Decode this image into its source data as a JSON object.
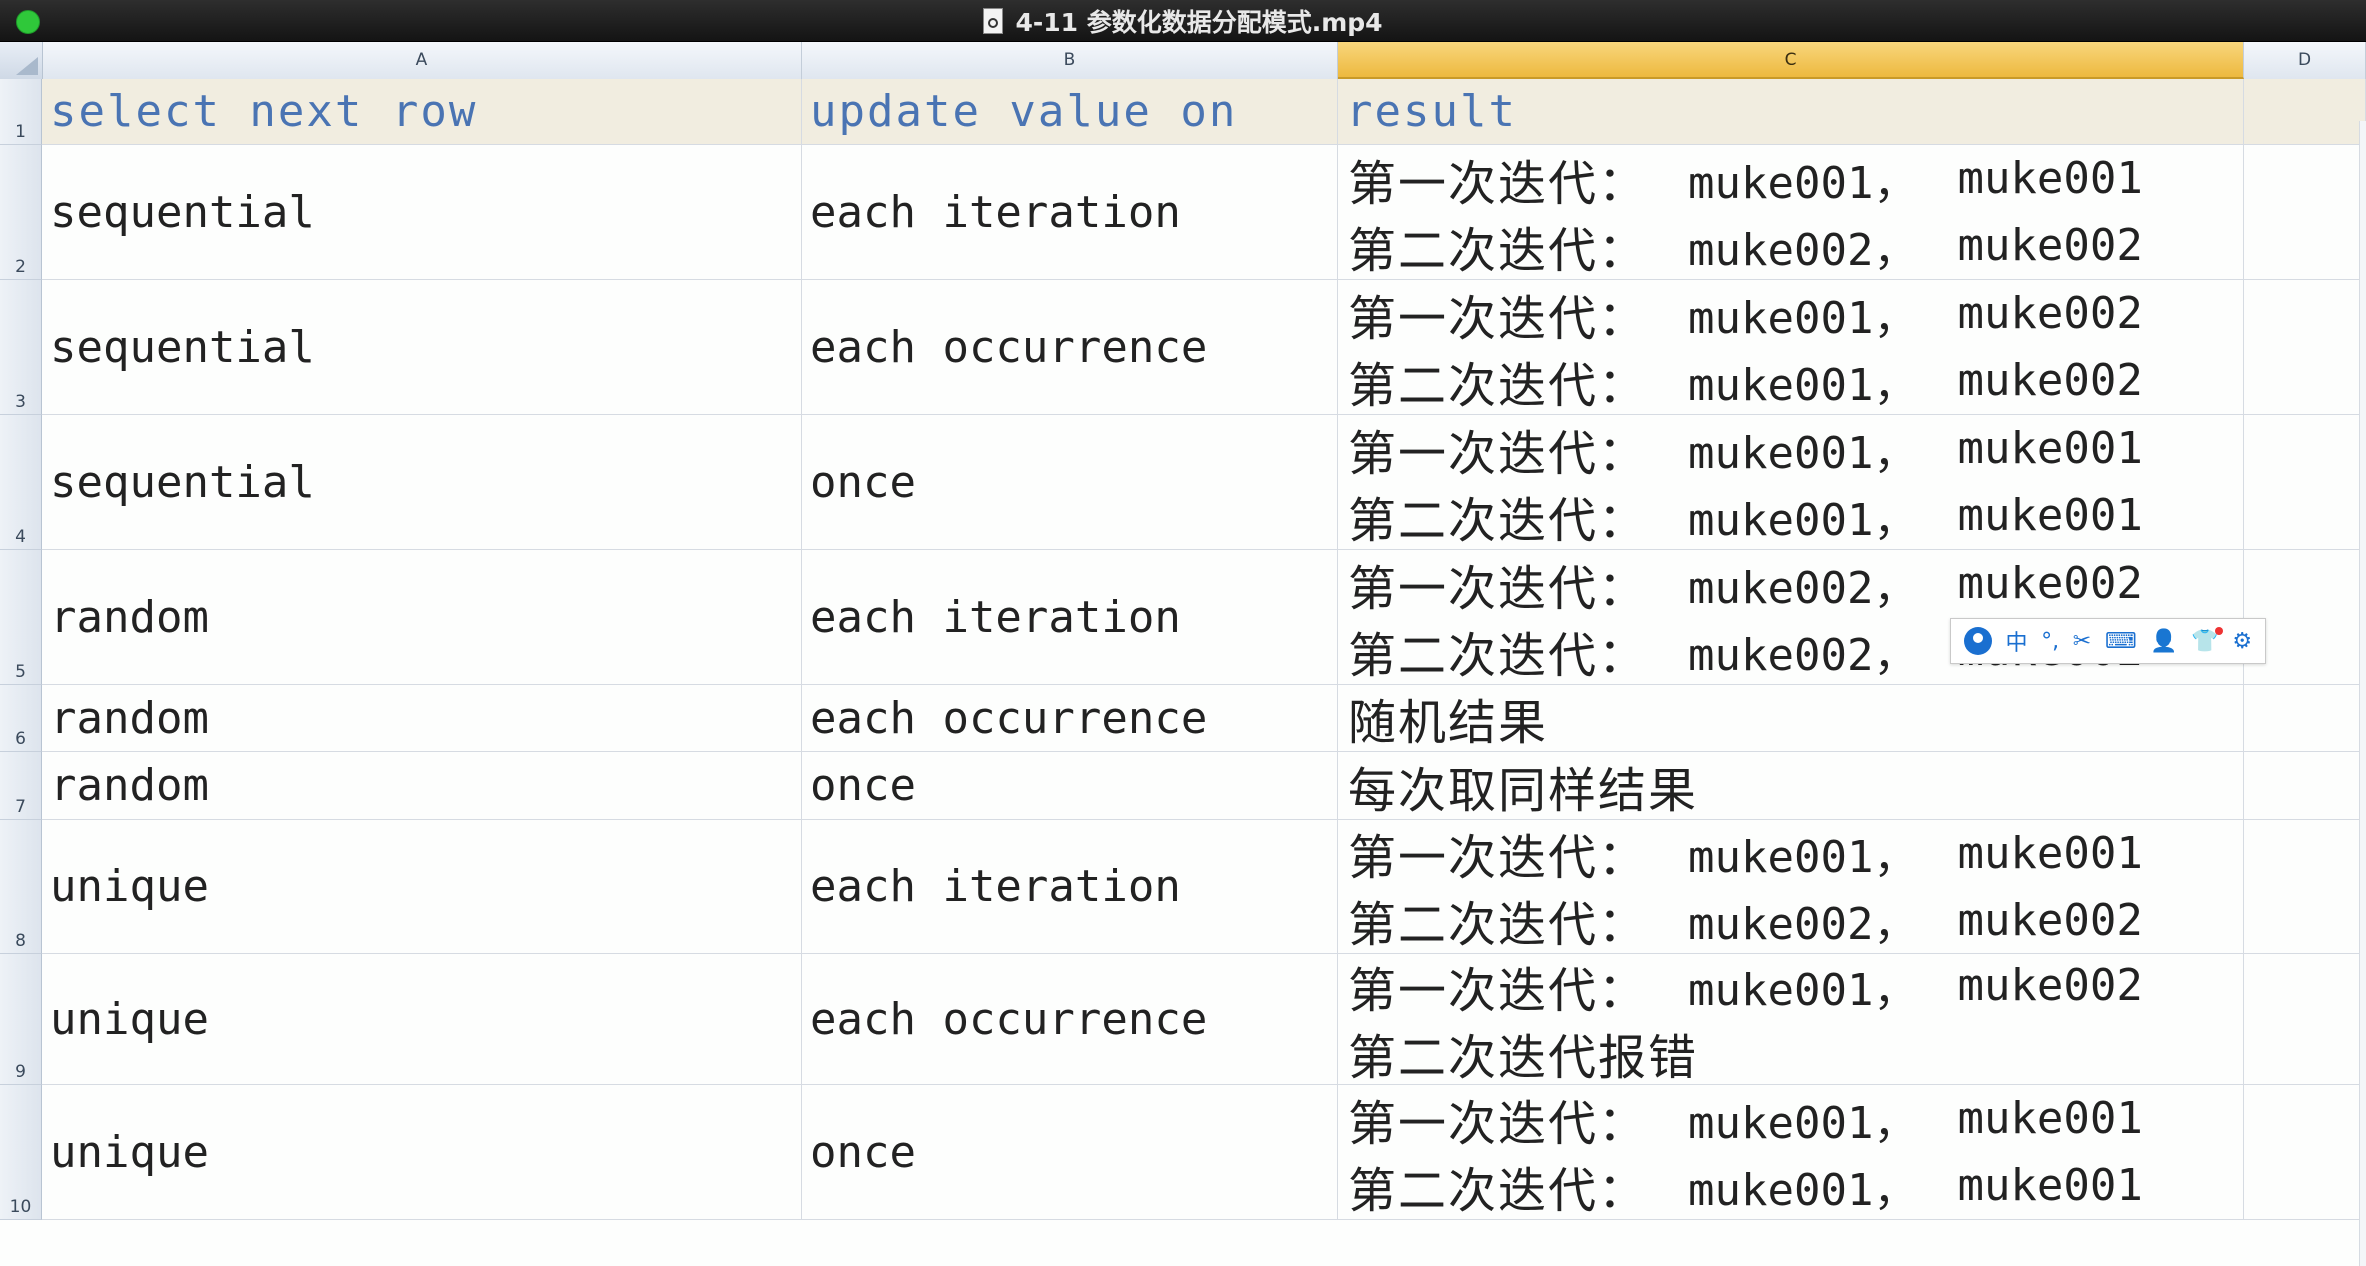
{
  "window": {
    "title": "4-11 参数化数据分配模式.mp4"
  },
  "columns": [
    "A",
    "B",
    "C",
    "D"
  ],
  "header": {
    "a": "select next row",
    "b": "update value on",
    "c": "result"
  },
  "rows": [
    {
      "num": "2",
      "a": "sequential",
      "b": "each iteration",
      "l1": {
        "label": "第一次迭代：",
        "v1": "muke001，",
        "v2": "muke001"
      },
      "l2": {
        "label": "第二次迭代：",
        "v1": "muke002，",
        "v2": "muke002"
      }
    },
    {
      "num": "3",
      "a": "sequential",
      "b": "each occurrence",
      "l1": {
        "label": "第一次迭代：",
        "v1": "muke001，",
        "v2": "muke002"
      },
      "l2": {
        "label": "第二次迭代：",
        "v1": "muke001，",
        "v2": "muke002"
      }
    },
    {
      "num": "4",
      "a": "sequential",
      "b": "once",
      "l1": {
        "label": "第一次迭代：",
        "v1": "muke001，",
        "v2": "muke001"
      },
      "l2": {
        "label": "第二次迭代：",
        "v1": "muke001，",
        "v2": "muke001"
      }
    },
    {
      "num": "5",
      "a": "random",
      "b": "each iteration",
      "l1": {
        "label": "第一次迭代：",
        "v1": "muke002，",
        "v2": "muke002"
      },
      "l2": {
        "label": "第二次迭代：",
        "v1": "muke002，",
        "v2": "muke002"
      }
    },
    {
      "num": "6",
      "a": "random",
      "b": "each occurrence",
      "single": "随机结果"
    },
    {
      "num": "7",
      "a": "random",
      "b": "once",
      "single": "每次取同样结果"
    },
    {
      "num": "8",
      "a": "unique",
      "b": "each iteration",
      "l1": {
        "label": "第一次迭代：",
        "v1": "muke001，",
        "v2": "muke001"
      },
      "l2": {
        "label": "第二次迭代：",
        "v1": "muke002，",
        "v2": "muke002"
      }
    },
    {
      "num": "9",
      "a": "unique",
      "b": "each occurrence",
      "l1": {
        "label": "第一次迭代：",
        "v1": "muke001，",
        "v2": "muke002"
      },
      "l2": {
        "label": "第二次迭代报错"
      }
    },
    {
      "num": "10",
      "a": "unique",
      "b": "once",
      "l1": {
        "label": "第一次迭代：",
        "v1": "muke001，",
        "v2": "muke001"
      },
      "l2": {
        "label": "第二次迭代：",
        "v1": "muke001，",
        "v2": "muke001"
      }
    }
  ],
  "row_header_1": "1",
  "ime_toolbar": {
    "lang": "中",
    "icons": [
      "user-icon",
      "punctuation-icon",
      "scissors-icon",
      "keyboard-icon",
      "person-icon",
      "skin-icon",
      "settings-icon"
    ]
  }
}
